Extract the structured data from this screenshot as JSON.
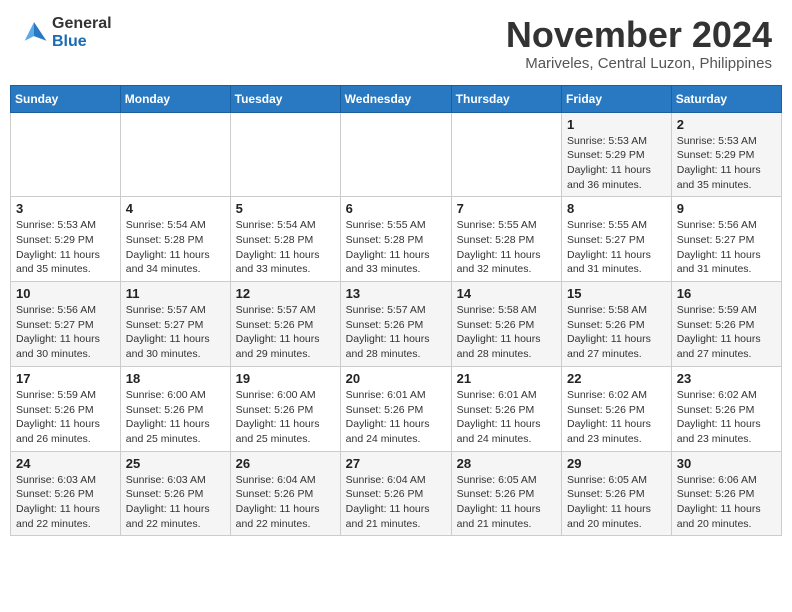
{
  "header": {
    "logo": {
      "general": "General",
      "blue": "Blue"
    },
    "month": "November 2024",
    "location": "Mariveles, Central Luzon, Philippines"
  },
  "weekdays": [
    "Sunday",
    "Monday",
    "Tuesday",
    "Wednesday",
    "Thursday",
    "Friday",
    "Saturday"
  ],
  "weeks": [
    [
      {
        "day": "",
        "info": ""
      },
      {
        "day": "",
        "info": ""
      },
      {
        "day": "",
        "info": ""
      },
      {
        "day": "",
        "info": ""
      },
      {
        "day": "",
        "info": ""
      },
      {
        "day": "1",
        "info": "Sunrise: 5:53 AM\nSunset: 5:29 PM\nDaylight: 11 hours\nand 36 minutes."
      },
      {
        "day": "2",
        "info": "Sunrise: 5:53 AM\nSunset: 5:29 PM\nDaylight: 11 hours\nand 35 minutes."
      }
    ],
    [
      {
        "day": "3",
        "info": "Sunrise: 5:53 AM\nSunset: 5:29 PM\nDaylight: 11 hours\nand 35 minutes."
      },
      {
        "day": "4",
        "info": "Sunrise: 5:54 AM\nSunset: 5:28 PM\nDaylight: 11 hours\nand 34 minutes."
      },
      {
        "day": "5",
        "info": "Sunrise: 5:54 AM\nSunset: 5:28 PM\nDaylight: 11 hours\nand 33 minutes."
      },
      {
        "day": "6",
        "info": "Sunrise: 5:55 AM\nSunset: 5:28 PM\nDaylight: 11 hours\nand 33 minutes."
      },
      {
        "day": "7",
        "info": "Sunrise: 5:55 AM\nSunset: 5:28 PM\nDaylight: 11 hours\nand 32 minutes."
      },
      {
        "day": "8",
        "info": "Sunrise: 5:55 AM\nSunset: 5:27 PM\nDaylight: 11 hours\nand 31 minutes."
      },
      {
        "day": "9",
        "info": "Sunrise: 5:56 AM\nSunset: 5:27 PM\nDaylight: 11 hours\nand 31 minutes."
      }
    ],
    [
      {
        "day": "10",
        "info": "Sunrise: 5:56 AM\nSunset: 5:27 PM\nDaylight: 11 hours\nand 30 minutes."
      },
      {
        "day": "11",
        "info": "Sunrise: 5:57 AM\nSunset: 5:27 PM\nDaylight: 11 hours\nand 30 minutes."
      },
      {
        "day": "12",
        "info": "Sunrise: 5:57 AM\nSunset: 5:26 PM\nDaylight: 11 hours\nand 29 minutes."
      },
      {
        "day": "13",
        "info": "Sunrise: 5:57 AM\nSunset: 5:26 PM\nDaylight: 11 hours\nand 28 minutes."
      },
      {
        "day": "14",
        "info": "Sunrise: 5:58 AM\nSunset: 5:26 PM\nDaylight: 11 hours\nand 28 minutes."
      },
      {
        "day": "15",
        "info": "Sunrise: 5:58 AM\nSunset: 5:26 PM\nDaylight: 11 hours\nand 27 minutes."
      },
      {
        "day": "16",
        "info": "Sunrise: 5:59 AM\nSunset: 5:26 PM\nDaylight: 11 hours\nand 27 minutes."
      }
    ],
    [
      {
        "day": "17",
        "info": "Sunrise: 5:59 AM\nSunset: 5:26 PM\nDaylight: 11 hours\nand 26 minutes."
      },
      {
        "day": "18",
        "info": "Sunrise: 6:00 AM\nSunset: 5:26 PM\nDaylight: 11 hours\nand 25 minutes."
      },
      {
        "day": "19",
        "info": "Sunrise: 6:00 AM\nSunset: 5:26 PM\nDaylight: 11 hours\nand 25 minutes."
      },
      {
        "day": "20",
        "info": "Sunrise: 6:01 AM\nSunset: 5:26 PM\nDaylight: 11 hours\nand 24 minutes."
      },
      {
        "day": "21",
        "info": "Sunrise: 6:01 AM\nSunset: 5:26 PM\nDaylight: 11 hours\nand 24 minutes."
      },
      {
        "day": "22",
        "info": "Sunrise: 6:02 AM\nSunset: 5:26 PM\nDaylight: 11 hours\nand 23 minutes."
      },
      {
        "day": "23",
        "info": "Sunrise: 6:02 AM\nSunset: 5:26 PM\nDaylight: 11 hours\nand 23 minutes."
      }
    ],
    [
      {
        "day": "24",
        "info": "Sunrise: 6:03 AM\nSunset: 5:26 PM\nDaylight: 11 hours\nand 22 minutes."
      },
      {
        "day": "25",
        "info": "Sunrise: 6:03 AM\nSunset: 5:26 PM\nDaylight: 11 hours\nand 22 minutes."
      },
      {
        "day": "26",
        "info": "Sunrise: 6:04 AM\nSunset: 5:26 PM\nDaylight: 11 hours\nand 22 minutes."
      },
      {
        "day": "27",
        "info": "Sunrise: 6:04 AM\nSunset: 5:26 PM\nDaylight: 11 hours\nand 21 minutes."
      },
      {
        "day": "28",
        "info": "Sunrise: 6:05 AM\nSunset: 5:26 PM\nDaylight: 11 hours\nand 21 minutes."
      },
      {
        "day": "29",
        "info": "Sunrise: 6:05 AM\nSunset: 5:26 PM\nDaylight: 11 hours\nand 20 minutes."
      },
      {
        "day": "30",
        "info": "Sunrise: 6:06 AM\nSunset: 5:26 PM\nDaylight: 11 hours\nand 20 minutes."
      }
    ]
  ]
}
